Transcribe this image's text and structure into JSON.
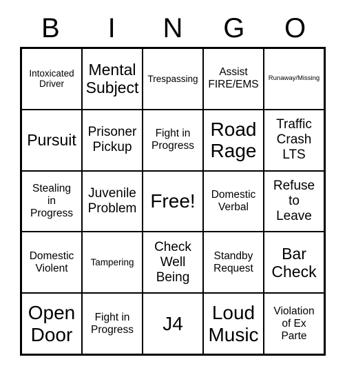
{
  "card": {
    "title_letters": [
      "B",
      "I",
      "N",
      "G",
      "O"
    ],
    "columns": [
      "B",
      "I",
      "N",
      "G",
      "O"
    ],
    "free_space_label": "Free!",
    "colors": {
      "border": "#000000",
      "cell_background": "#ffffff",
      "text": "#000000",
      "page_background": "#ffffff"
    },
    "rows": [
      [
        {
          "text": "Intoxicated\nDriver",
          "size": "sm"
        },
        {
          "text": "Mental\nSubject",
          "size": "xl"
        },
        {
          "text": "Trespassing",
          "size": "sm"
        },
        {
          "text": "Assist\nFIRE/EMS",
          "size": "md"
        },
        {
          "text": "Runaway/Missing",
          "size": "xs"
        }
      ],
      [
        {
          "text": "Pursuit",
          "size": "xl"
        },
        {
          "text": "Prisoner\nPickup",
          "size": "lg"
        },
        {
          "text": "Fight in\nProgress",
          "size": "md"
        },
        {
          "text": "Road\nRage",
          "size": "xxl"
        },
        {
          "text": "Traffic\nCrash\nLTS",
          "size": "lg"
        }
      ],
      [
        {
          "text": "Stealing\nin\nProgress",
          "size": "md"
        },
        {
          "text": "Juvenile\nProblem",
          "size": "lg"
        },
        {
          "text": "Free!",
          "size": "xxl"
        },
        {
          "text": "Domestic\nVerbal",
          "size": "md"
        },
        {
          "text": "Refuse\nto\nLeave",
          "size": "lg"
        }
      ],
      [
        {
          "text": "Domestic\nViolent",
          "size": "md"
        },
        {
          "text": "Tampering",
          "size": "sm"
        },
        {
          "text": "Check\nWell\nBeing",
          "size": "lg"
        },
        {
          "text": "Standby\nRequest",
          "size": "md"
        },
        {
          "text": "Bar\nCheck",
          "size": "xl"
        }
      ],
      [
        {
          "text": "Open\nDoor",
          "size": "xxl"
        },
        {
          "text": "Fight in\nProgress",
          "size": "md"
        },
        {
          "text": "J4",
          "size": "xxl"
        },
        {
          "text": "Loud\nMusic",
          "size": "xxl"
        },
        {
          "text": "Violation\nof Ex\nParte",
          "size": "md"
        }
      ]
    ]
  }
}
